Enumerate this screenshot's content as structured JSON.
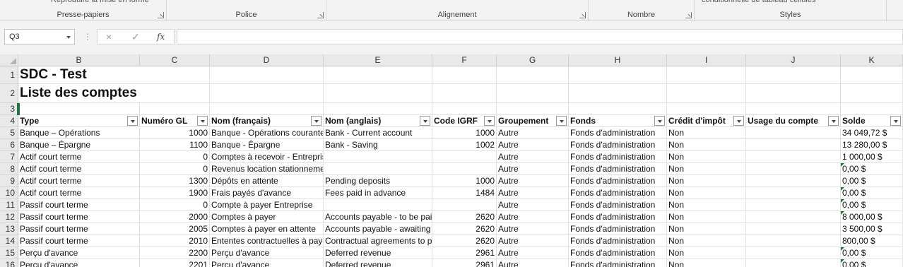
{
  "ribbon": {
    "groups": [
      {
        "label": "Presse-papiers",
        "partial": "Reproduire la mise en forme",
        "launcher": true
      },
      {
        "label": "Police",
        "partial": "",
        "launcher": true
      },
      {
        "label": "Alignement",
        "partial": "",
        "launcher": true
      },
      {
        "label": "Nombre",
        "partial": "",
        "launcher": true
      },
      {
        "label": "Styles",
        "partial": "conditionnelle      de tableau      cellules",
        "launcher": false
      }
    ]
  },
  "formula_bar": {
    "name_box": "Q3",
    "cancel_icon": "×",
    "enter_icon": "✓",
    "fx_label": "fx",
    "formula": ""
  },
  "grid": {
    "columns": [
      "B",
      "C",
      "D",
      "E",
      "F",
      "G",
      "H",
      "I",
      "J",
      "K"
    ],
    "row_numbers": [
      "1",
      "2",
      "3",
      "4",
      "5",
      "6",
      "7",
      "8",
      "9",
      "10",
      "11",
      "12",
      "13",
      "14",
      "15",
      "16"
    ],
    "title": "SDC - Test",
    "subtitle": "Liste des comptes",
    "headers": [
      "Type",
      "Numéro GL",
      "Nom (français)",
      "Nom (anglais)",
      "Code IGRF",
      "Groupement",
      "Fonds",
      "Crédit d'impôt",
      "Usage du compte",
      "Solde"
    ],
    "rows": [
      [
        "Banque – Opérations",
        "1000",
        "Banque - Opérations courantes",
        "Bank - Current account",
        "1000",
        "Autre",
        "Fonds d'administration",
        "Non",
        "",
        "34 049,72 $"
      ],
      [
        "Banque – Épargne",
        "1100",
        "Banque - Épargne",
        "Bank - Saving",
        "1002",
        "Autre",
        "Fonds d'administration",
        "Non",
        "",
        "13 280,00 $"
      ],
      [
        "Actif court terme",
        "0",
        "Comptes à recevoir - Entreprise",
        "",
        "",
        "Autre",
        "Fonds d'administration",
        "Non",
        "",
        "1 000,00 $"
      ],
      [
        "Actif court terme",
        "0",
        "Revenus location stationnement",
        "",
        "",
        "Autre",
        "Fonds d'administration",
        "Non",
        "",
        "0,00 $"
      ],
      [
        "Actif court terme",
        "1300",
        "Dépôts en attente",
        "Pending deposits",
        "1000",
        "Autre",
        "Fonds d'administration",
        "Non",
        "",
        "0,00 $"
      ],
      [
        "Actif court terme",
        "1900",
        "Frais payés d'avance",
        "Fees paid in advance",
        "1484",
        "Autre",
        "Fonds d'administration",
        "Non",
        "",
        "0,00 $"
      ],
      [
        "Passif court terme",
        "0",
        "Compte à payer Entreprise",
        "",
        "",
        "Autre",
        "Fonds d'administration",
        "Non",
        "",
        "0,00 $"
      ],
      [
        "Passif court terme",
        "2000",
        "Comptes à payer",
        "Accounts payable - to be paid",
        "2620",
        "Autre",
        "Fonds d'administration",
        "Non",
        "",
        "8 000,00 $"
      ],
      [
        "Passif court terme",
        "2005",
        "Comptes à payer en attente",
        "Accounts payable - awaiting",
        "2620",
        "Autre",
        "Fonds d'administration",
        "Non",
        "",
        "3 500,00 $"
      ],
      [
        "Passif court terme",
        "2010",
        "Ententes contractuelles à payer",
        "Contractual agreements to pay",
        "2620",
        "Autre",
        "Fonds d'administration",
        "Non",
        "",
        "800,00 $"
      ],
      [
        "Perçu d'avance",
        "2200",
        "Perçu d'avance",
        "Deferred revenue",
        "2961",
        "Autre",
        "Fonds d'administration",
        "Non",
        "",
        "0,00 $"
      ],
      [
        "Perçu d'avance",
        "2201",
        "Perçu d'avance",
        "Deferred revenue",
        "2961",
        "Autre",
        "Fonds d'administration",
        "Non",
        "",
        "0,00 $"
      ]
    ],
    "error_indicator_rows": [
      3,
      5,
      6,
      7,
      10,
      11,
      12
    ],
    "accent_color": "#217346",
    "error_indicator_color": "#1e7b34"
  }
}
